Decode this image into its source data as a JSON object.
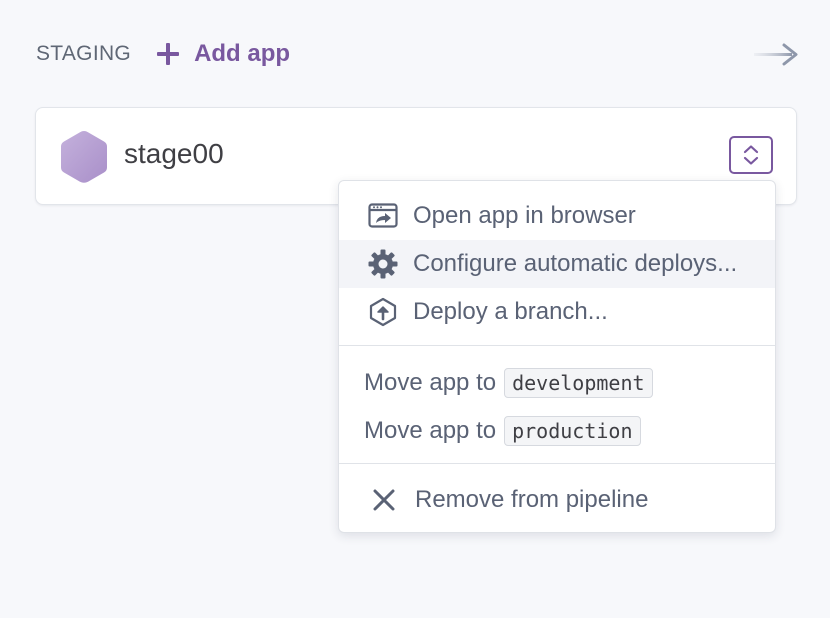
{
  "stage": {
    "title": "STAGING",
    "add_app_label": "Add app"
  },
  "app": {
    "name": "stage00"
  },
  "menu": {
    "items": [
      {
        "label": "Open app in browser",
        "icon": "browser-open-icon"
      },
      {
        "label": "Configure automatic deploys...",
        "icon": "gear-icon"
      },
      {
        "label": "Deploy a branch...",
        "icon": "deploy-upload-icon"
      }
    ],
    "move": [
      {
        "prefix": "Move app to",
        "target": "development"
      },
      {
        "prefix": "Move app to",
        "target": "production"
      }
    ],
    "remove_label": "Remove from pipeline"
  },
  "colors": {
    "accent": "#79589f",
    "text": "#5a6275",
    "background": "#f7f8fb"
  }
}
